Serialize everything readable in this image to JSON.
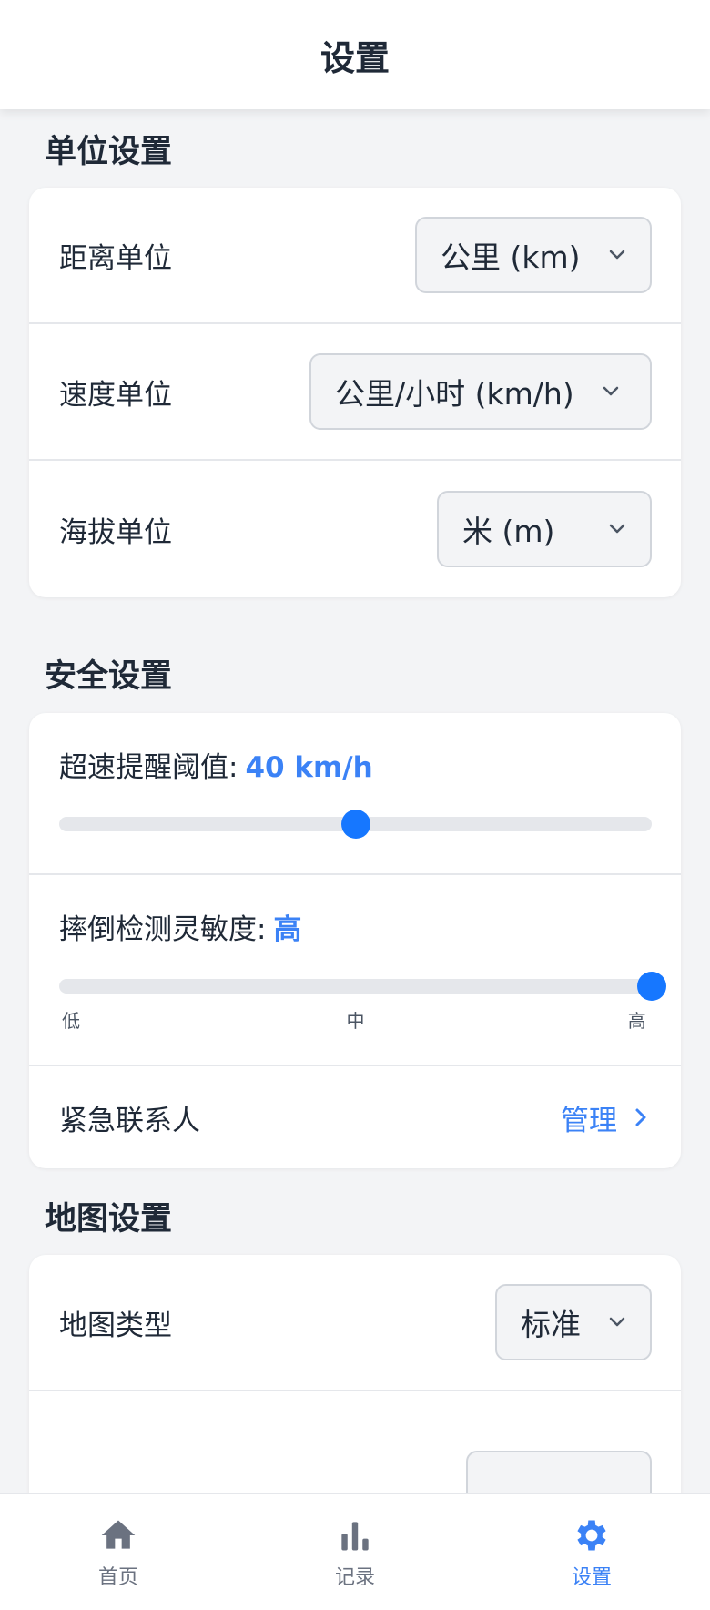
{
  "header": {
    "title": "设置"
  },
  "units": {
    "section_title": "单位设置",
    "distance": {
      "label": "距离单位",
      "value": "公里 (km)"
    },
    "speed": {
      "label": "速度单位",
      "value": "公里/小时 (km/h)"
    },
    "altitude": {
      "label": "海拔单位",
      "value": "米 (m)"
    }
  },
  "safety": {
    "section_title": "安全设置",
    "speed_alert": {
      "label": "超速提醒阈值:",
      "value": "40 km/h",
      "level": 0.5
    },
    "fall_detection": {
      "label": "摔倒检测灵敏度:",
      "value": "高",
      "level": 1.0,
      "ticks": [
        "低",
        "中",
        "高"
      ]
    },
    "emergency": {
      "label": "紧急联系人",
      "action": "管理"
    }
  },
  "map": {
    "section_title": "地图设置",
    "type": {
      "label": "地图类型",
      "value": "标准"
    }
  },
  "nav": {
    "items": [
      {
        "label": "首页",
        "icon": "home-icon"
      },
      {
        "label": "记录",
        "icon": "bar-chart-icon"
      },
      {
        "label": "设置",
        "icon": "gear-icon",
        "active": true
      }
    ]
  },
  "colors": {
    "accent": "#3b82f6",
    "thumb": "#1677ff"
  }
}
